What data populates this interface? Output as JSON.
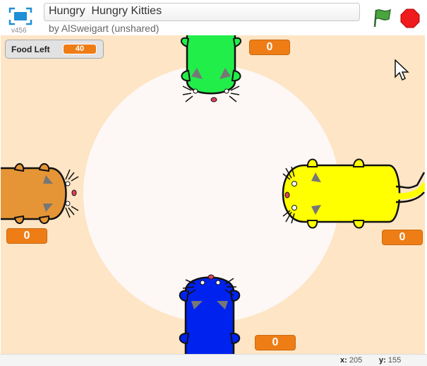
{
  "header": {
    "version": "v456",
    "project_title": "Hungry  Hungry Kitties",
    "byline": "by AlSweigart (unshared)"
  },
  "stage": {
    "monitor": {
      "label": "Food Left",
      "value": "40"
    },
    "scores": {
      "top": "0",
      "left": "0",
      "right": "0",
      "bottom": "0"
    },
    "colors": {
      "background": "#fde5c5",
      "plate": "#fdf8f5",
      "green_kitty": "#22ee4a",
      "orange_kitty": "#e59536",
      "yellow_kitty": "#ffff00",
      "blue_kitty": "#0022ee",
      "score_badge": "#ee7d16"
    }
  },
  "footer": {
    "x_label": "x:",
    "x_value": "205",
    "y_label": "y:",
    "y_value": "155"
  },
  "icons": [
    "fullscreen-icon",
    "green-flag-icon",
    "stop-icon",
    "mouse-cursor-icon"
  ]
}
